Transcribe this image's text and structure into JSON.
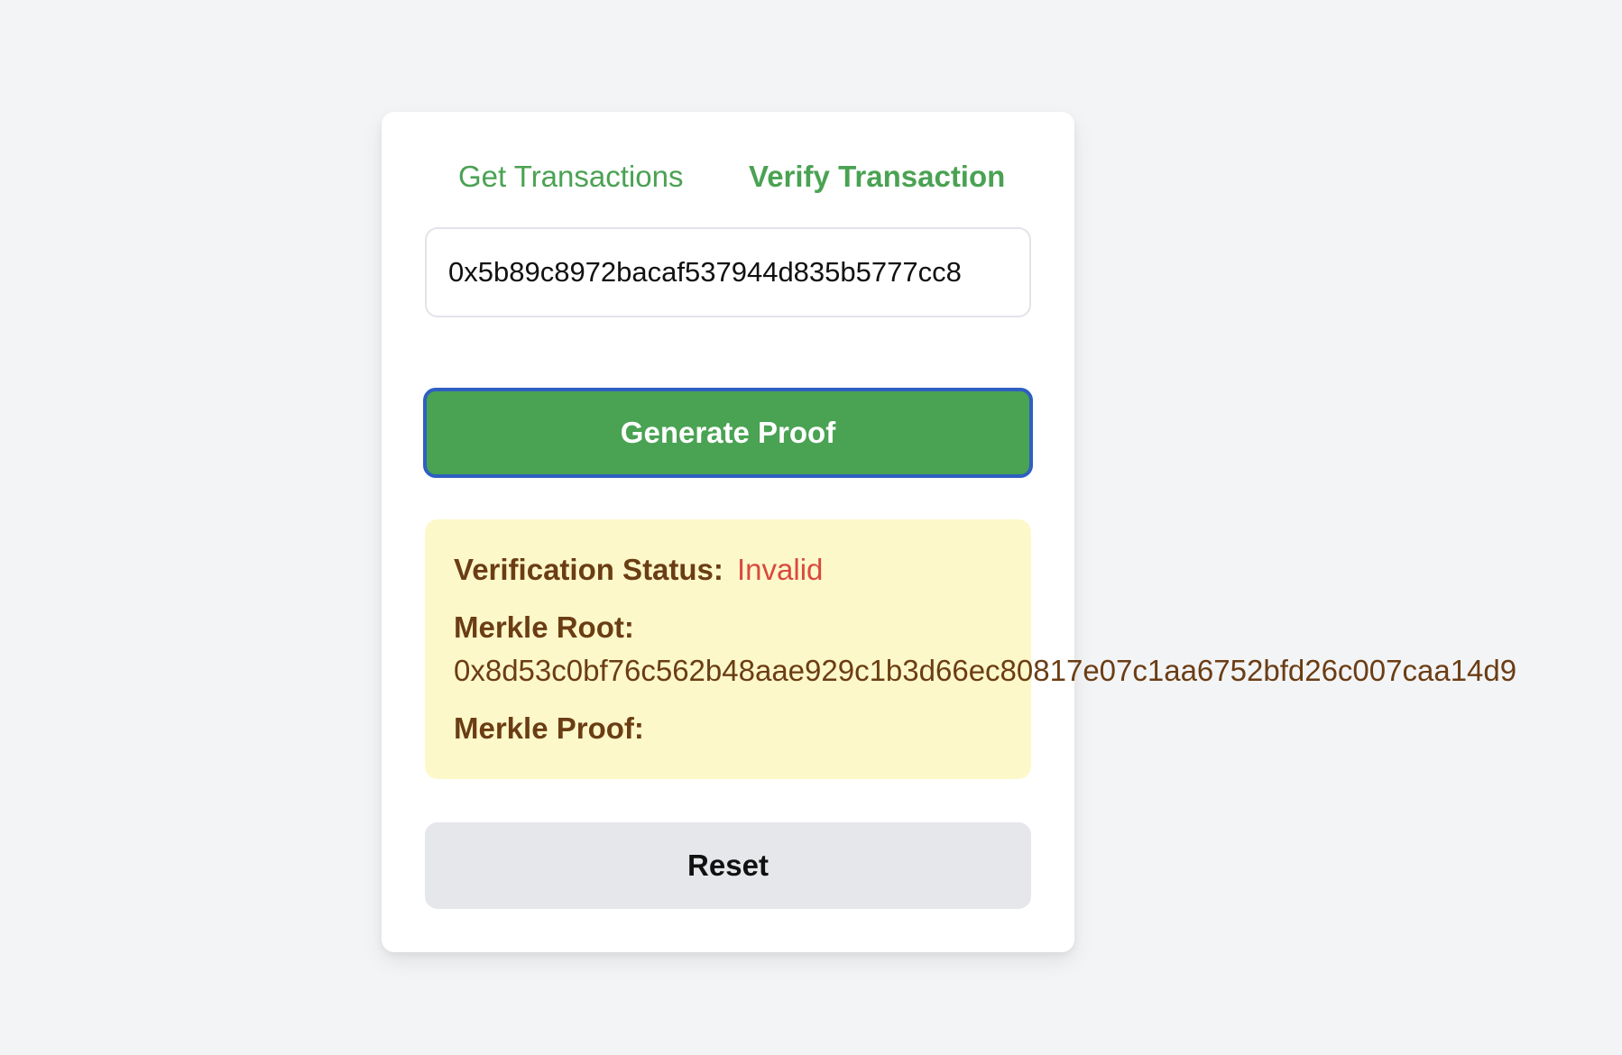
{
  "tabs": {
    "get_transactions": "Get Transactions",
    "verify_transaction": "Verify Transaction"
  },
  "transaction_input": {
    "value": "0x5b89c8972bacaf537944d835b5777cc8"
  },
  "generate_button": {
    "label": "Generate Proof"
  },
  "result": {
    "status_label": "Verification Status:",
    "status_value": "Invalid",
    "merkle_root_label": "Merkle Root:",
    "merkle_root_value": "0x8d53c0bf76c562b48aae929c1b3d66ec80817e07c1aa6752bfd26c007caa14d9",
    "merkle_proof_label": "Merkle Proof:"
  },
  "reset_button": {
    "label": "Reset"
  },
  "colors": {
    "accent_green": "#4aa253",
    "invalid_red": "#d9493f",
    "result_bg": "#fdf8c9",
    "result_text": "#6b3d14",
    "focus_ring": "#2f5fc0",
    "page_bg": "#f3f4f6"
  }
}
